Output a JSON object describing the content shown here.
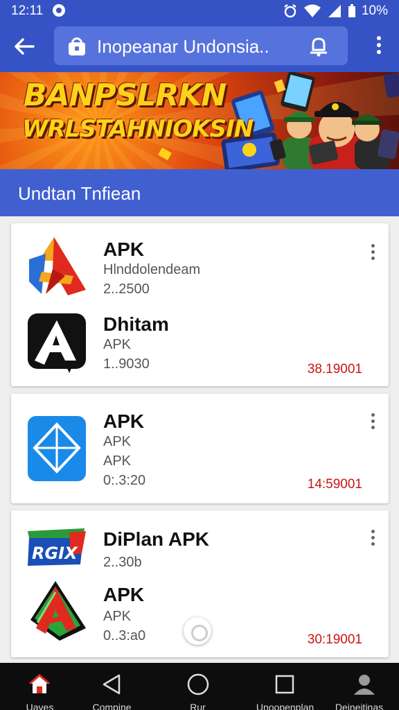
{
  "status_bar": {
    "time": "12:11",
    "battery": "10%"
  },
  "address_bar": {
    "url_text": "Inopeanar Undonsia.."
  },
  "banner": {
    "line1": "BANPSLRKN",
    "line2": "WRLSTAHNIOKSIN"
  },
  "section": {
    "title": "Undtan Tnfiean"
  },
  "cards": [
    {
      "apps": [
        {
          "icon": "red-blue-a-logo-icon",
          "title": "APK",
          "lines": [
            "Hlnddolendeam",
            "2..2500"
          ],
          "price": ""
        },
        {
          "icon": "black-a-logo-icon",
          "title": "Dhitam",
          "lines": [
            "APK",
            "1..9030"
          ],
          "price": "38.19001"
        }
      ]
    },
    {
      "apps": [
        {
          "icon": "blue-diamond-logo-icon",
          "title": "APK",
          "lines": [
            "APK",
            "APK",
            "0:.3:20"
          ],
          "price": "14:59001"
        }
      ]
    },
    {
      "apps": [
        {
          "icon": "rgix-logo-icon",
          "title": "DiPlan APK",
          "lines": [
            "2..30b"
          ],
          "price": ""
        },
        {
          "icon": "green-red-a-logo-icon",
          "title": "APK",
          "lines": [
            "APK",
            "0..3:a0"
          ],
          "price": "30:19001"
        }
      ]
    }
  ],
  "rgix_logo_text": "RGIX",
  "bottom_nav": [
    {
      "label": "Uaves",
      "icon": "home-icon"
    },
    {
      "label": "Compine",
      "icon": "back-triangle-icon"
    },
    {
      "label": "Rur",
      "icon": "circle-home-icon"
    },
    {
      "label": "Unoopenplan",
      "icon": "square-recents-icon"
    },
    {
      "label": "Deineitinas",
      "icon": "profile-icon"
    }
  ],
  "colors": {
    "app_bar": "#3553c4",
    "section": "#4060d0",
    "price": "#cc1414",
    "nav_bg": "#0d0d0d"
  }
}
